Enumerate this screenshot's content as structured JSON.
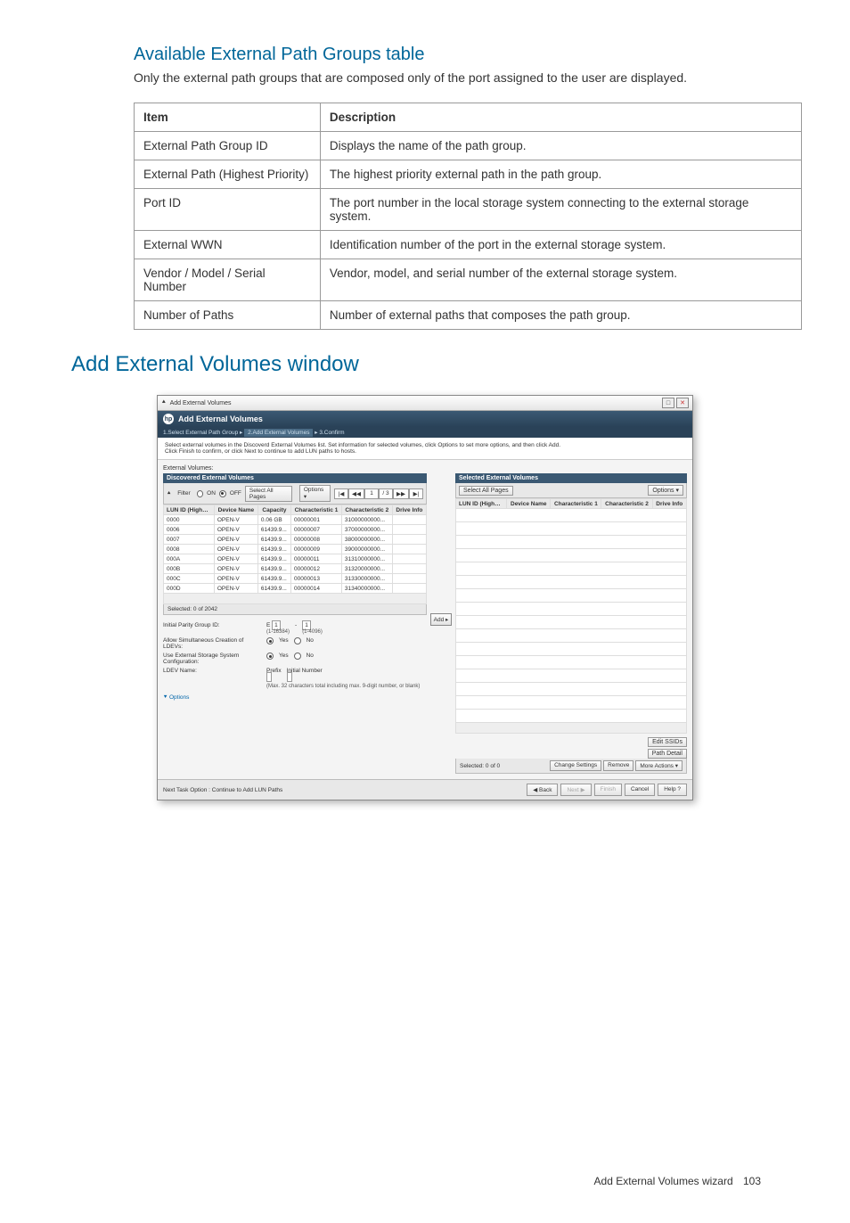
{
  "section1": {
    "title": "Available External Path Groups table",
    "description": "Only the external path groups that are composed only of the port assigned to the user are displayed.",
    "table": {
      "headers": [
        "Item",
        "Description"
      ],
      "rows": [
        [
          "External Path Group ID",
          "Displays the name of the path group."
        ],
        [
          "External Path (Highest Priority)",
          "The highest priority external path in the path group."
        ],
        [
          "Port ID",
          "The port number in the local storage system connecting to the external storage system."
        ],
        [
          "External WWN",
          "Identification number of the port in the external storage system."
        ],
        [
          "Vendor / Model / Serial Number",
          "Vendor, model, and serial number of the external storage system."
        ],
        [
          "Number of Paths",
          "Number of external paths that composes the path group."
        ]
      ]
    }
  },
  "section2": {
    "title": "Add External Volumes window"
  },
  "screenshot": {
    "titlebar": "Add External Volumes",
    "header": "Add External Volumes",
    "breadcrumb": {
      "step1": "1.Select External Path Group",
      "sep": "▸",
      "step2": "2.Add External Volumes",
      "step3": "3.Confirm"
    },
    "instructions": [
      "Select external volumes in the Discoverd External Volumes list. Set information for selected volumes, click Options to set more options, and then click Add.",
      "Click Finish to confirm, or click Next to continue to add LUN paths to hosts."
    ],
    "left_panel": {
      "label": "External Volumes:",
      "header": "Discovered External Volumes",
      "filter_label": "Filter",
      "filter_on": "ON",
      "filter_off": "OFF",
      "select_all_pages": "Select All Pages",
      "options": "Options ▾",
      "pager": {
        "first": "|◀",
        "prev": "◀◀",
        "current": "1",
        "total": "/ 3",
        "next": "▶▶",
        "last": "▶|"
      },
      "columns": [
        "LUN ID (Highest Priority)",
        "Device Name",
        "Capacity",
        "Characteristic 1",
        "Characteristic 2",
        "Drive Info"
      ],
      "rows": [
        [
          "0000",
          "OPEN-V",
          "0.06 GB",
          "00000001",
          "31000000000...",
          ""
        ],
        [
          "0006",
          "OPEN-V",
          "61439.9...",
          "00000007",
          "37000000000...",
          ""
        ],
        [
          "0007",
          "OPEN-V",
          "61439.9...",
          "00000008",
          "38000000000...",
          ""
        ],
        [
          "0008",
          "OPEN-V",
          "61439.9...",
          "00000009",
          "39000000000...",
          ""
        ],
        [
          "000A",
          "OPEN-V",
          "61439.9...",
          "00000011",
          "31310000000...",
          ""
        ],
        [
          "000B",
          "OPEN-V",
          "61439.9...",
          "00000012",
          "31320000000...",
          ""
        ],
        [
          "000C",
          "OPEN-V",
          "61439.9...",
          "00000013",
          "31330000000...",
          ""
        ],
        [
          "000D",
          "OPEN-V",
          "61439.9...",
          "00000014",
          "31340000000...",
          ""
        ]
      ],
      "selected": "Selected: 0  of 2042"
    },
    "add_button": "Add ▸",
    "right_panel": {
      "header": "Selected External Volumes",
      "select_all_pages": "Select All Pages",
      "options": "Options ▾",
      "columns": [
        "LUN ID (Highest Priority)",
        "Device Name",
        "Characteristic 1",
        "Characteristic 2",
        "Drive Info"
      ],
      "selected": "Selected: 0  of 0",
      "edit_ssids": "Edit SSIDs",
      "path_detail": "Path Detail",
      "change_settings": "Change Settings",
      "remove": "Remove",
      "more_actions": "More Actions ▾"
    },
    "form": {
      "parity_group": {
        "label": "Initial Parity Group ID:",
        "prefix": "E",
        "val1": "1",
        "range1": "(1-16384)",
        "sep": "-",
        "val2": "1",
        "range2": "(1-4096)"
      },
      "simultaneous": {
        "label": "Allow Simultaneous Creation of LDEVs:",
        "yes": "Yes",
        "no": "No"
      },
      "use_ext": {
        "label": "Use External Storage System Configuration:",
        "yes": "Yes",
        "no": "No"
      },
      "ldev_name": {
        "label": "LDEV Name:",
        "prefix_label": "Prefix",
        "initnum_label": "Initial Number",
        "hint": "(Max. 32 characters total including max. 9-digit number, or blank)"
      },
      "options_link": "⯆ Options"
    },
    "footer": {
      "next_task": "Next Task Option : Continue to Add LUN Paths",
      "back": "◀ Back",
      "next": "Next ▶",
      "finish": "Finish",
      "cancel": "Cancel",
      "help": "Help ?"
    }
  },
  "page_footer": {
    "text": "Add External Volumes wizard",
    "num": "103"
  }
}
